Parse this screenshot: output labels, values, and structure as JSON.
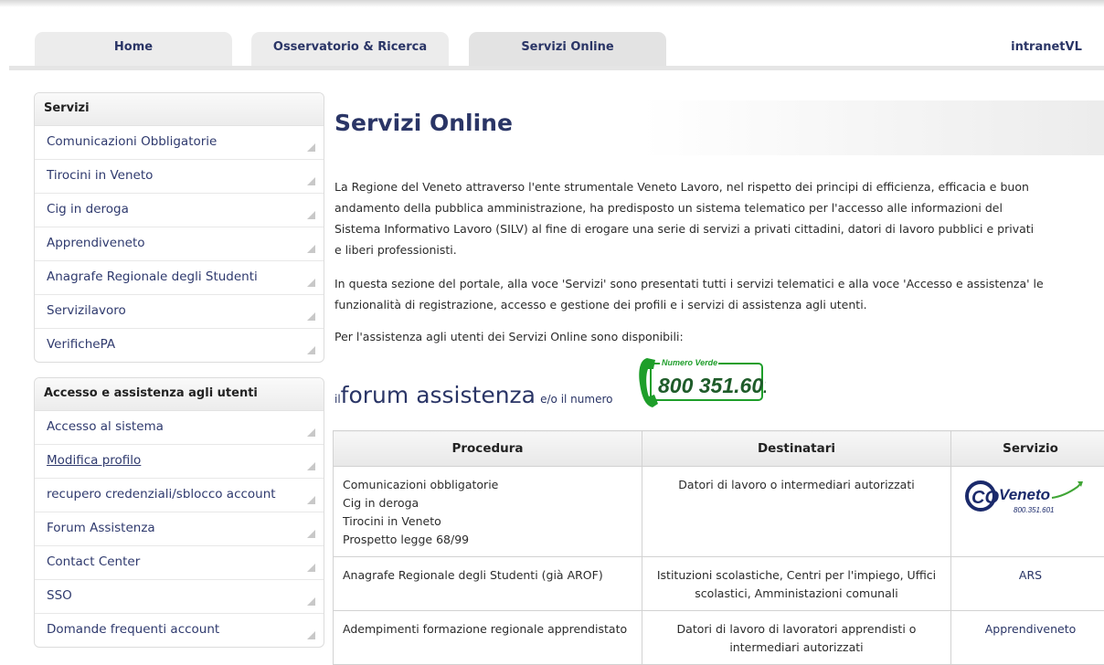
{
  "nav": {
    "tabs": [
      "Home",
      "Osservatorio & Ricerca",
      "Servizi Online",
      "intranetVL"
    ]
  },
  "sidebar": {
    "servizi_title": "Servizi",
    "servizi_items": [
      "Comunicazioni Obbligatorie",
      "Tirocini in Veneto",
      "Cig in deroga",
      "Apprendiveneto",
      "Anagrafe Regionale degli Studenti",
      "Servizilavoro",
      "VerifichePA"
    ],
    "accesso_title": "Accesso e assistenza agli utenti",
    "accesso_items": [
      "Accesso al sistema",
      "Modifica profilo",
      "recupero credenziali/sblocco account",
      "Forum Assistenza",
      "Contact Center",
      "SSO",
      "Domande frequenti account"
    ]
  },
  "main": {
    "title": "Servizi Online",
    "p1": [
      "La Regione del Veneto attraverso l'ente strumentale Veneto Lavoro, nel rispetto dei principi di efficienza, efficacia e buon",
      "andamento della pubblica amministrazione, ha predisposto un sistema telematico per l'accesso alle informazioni del",
      "Sistema Informativo Lavoro (SILV) al fine di erogare una serie di servizi a privati cittadini, datori di lavoro pubblici e privati",
      "e liberi professionisti."
    ],
    "p2": [
      "In questa sezione del portale, alla voce  'Servizi'  sono presentati tutti i servizi telematici e alla voce 'Accesso e assistenza' le",
      "funzionalità di registrazione, accesso e gestione dei profili e i servizi di assistenza agli utenti."
    ],
    "p3": "Per l'assistenza agli utenti dei Servizi Online sono disponibili:",
    "forum_prefix": "il",
    "forum_link": "forum assistenza",
    "forum_suffix": "e/o il numero",
    "numero_verde_label": "Numero Verde",
    "numero_verde": "800 351.601"
  },
  "table": {
    "headers": [
      "Procedura",
      "Destinatari",
      "Servizio"
    ],
    "rows": [
      {
        "procedura": [
          "Comunicazioni obbligatorie",
          "Cig in deroga",
          "Tirocini in Veneto",
          "Prospetto legge 68/99"
        ],
        "destinatari": "Datori di lavoro o intermediari autorizzati",
        "logo_text": "Veneto",
        "logo_co": "CO",
        "logo_phone": "800.351.601"
      },
      {
        "procedura": [
          "Anagrafe Regionale degli Studenti (già AROF)"
        ],
        "destinatari": "Istituzioni scolastiche, Centri per l'impiego, Uffici scolastici, Amministazioni comunali",
        "servizio": "ARS"
      },
      {
        "procedura": [
          "Adempimenti formazione regionale apprendistato"
        ],
        "destinatari": "Datori di lavoro di lavoratori apprendisti o intermediari autorizzati",
        "servizio": "Apprendiveneto"
      }
    ]
  },
  "colors": {
    "accent": "#2a3566",
    "green": "#1e9e2a"
  }
}
